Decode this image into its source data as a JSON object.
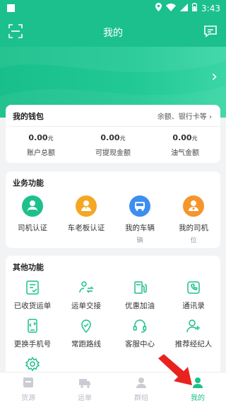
{
  "status_bar": {
    "time": "3:43"
  },
  "header": {
    "title": "我的"
  },
  "wallet": {
    "title": "我的钱包",
    "more": "余额、银行卡等",
    "columns": [
      {
        "value": "0.00",
        "unit": "元",
        "label": "账户总额"
      },
      {
        "value": "0.00",
        "unit": "元",
        "label": "可提现金额"
      },
      {
        "value": "0.00",
        "unit": "元",
        "label": "油气金额"
      }
    ]
  },
  "business": {
    "title": "业务功能",
    "items": [
      {
        "label": "司机认证",
        "sub": "",
        "icon": "driver-cert-icon",
        "color": "#1cc08c"
      },
      {
        "label": "车老板认证",
        "sub": "",
        "icon": "owner-cert-icon",
        "color": "#f5a623"
      },
      {
        "label": "我的车辆",
        "sub": "辆",
        "icon": "truck-icon",
        "color": "#3d8ef0"
      },
      {
        "label": "我的司机",
        "sub": "位",
        "icon": "my-driver-icon",
        "color": "#f5952b"
      }
    ]
  },
  "other": {
    "title": "其他功能",
    "items": [
      {
        "label": "已收货运单",
        "icon": "received-waybill-icon"
      },
      {
        "label": "运单交接",
        "icon": "waybill-handover-icon"
      },
      {
        "label": "优惠加油",
        "icon": "fuel-icon"
      },
      {
        "label": "通讯录",
        "icon": "contacts-icon"
      },
      {
        "label": "更换手机号",
        "icon": "change-phone-icon"
      },
      {
        "label": "常跑路线",
        "icon": "route-icon"
      },
      {
        "label": "客服中心",
        "icon": "customer-service-icon"
      },
      {
        "label": "推荐经纪人",
        "icon": "recommend-agent-icon"
      },
      {
        "label": "",
        "icon": "settings-icon"
      }
    ]
  },
  "tabbar": {
    "tabs": [
      {
        "label": "货源",
        "icon": "cargo-icon",
        "active": false
      },
      {
        "label": "运单",
        "icon": "waybill-truck-icon",
        "active": false
      },
      {
        "label": "群组",
        "icon": "group-icon",
        "active": false
      },
      {
        "label": "我的",
        "icon": "profile-icon",
        "active": true
      }
    ]
  },
  "colors": {
    "primary": "#1cc08c",
    "arrow": "#e8231f",
    "inactive_tab": "#b9bcc2"
  }
}
